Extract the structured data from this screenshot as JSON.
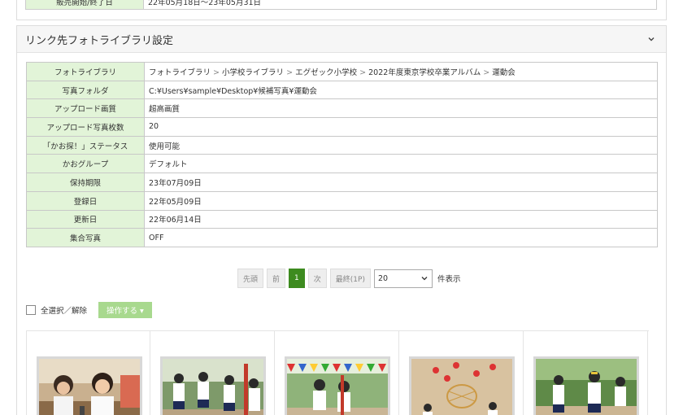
{
  "prev_row": {
    "label": "販売開始/終了日",
    "value": "22年05月18日～23年05月31日"
  },
  "panel": {
    "title": "リンク先フォトライブラリ設定"
  },
  "breadcrumb": [
    "フォトライブラリ",
    "小学校ライブラリ",
    "エグゼック小学校",
    "2022年度東京学校卒業アルバム",
    "運動会"
  ],
  "breadcrumb_sep": ">",
  "rows": [
    {
      "label": "フォトライブラリ"
    },
    {
      "label": "写真フォルダ",
      "value": "C:¥Users¥sample¥Desktop¥候補写真¥運動会"
    },
    {
      "label": "アップロード画質",
      "value": "超高画質"
    },
    {
      "label": "アップロード写真枚数",
      "value": "20"
    },
    {
      "label": "「かお探！」ステータス",
      "value": "使用可能"
    },
    {
      "label": "かおグループ",
      "value": "デフォルト"
    },
    {
      "label": "保持期限",
      "value": "23年07月09日"
    },
    {
      "label": "登録日",
      "value": "22年05月09日"
    },
    {
      "label": "更新日",
      "value": "22年06月14日"
    },
    {
      "label": "集合写真",
      "value": "OFF"
    }
  ],
  "pager": {
    "first": "先頭",
    "prev": "前",
    "page": "1",
    "next": "次",
    "last": "最終(1P)",
    "per_page": "20",
    "suffix": "件表示"
  },
  "bulk": {
    "select_all": "全選択／解除",
    "action": "操作する ▾"
  },
  "thumbnails": [
    "photo-kids-table",
    "photo-dance",
    "photo-flags-run",
    "photo-ball-basket",
    "photo-relay-run"
  ],
  "colors": {
    "label_bg": "#e2f4d8",
    "active_page": "#3d8b1f",
    "action_btn": "#a8d98e"
  }
}
